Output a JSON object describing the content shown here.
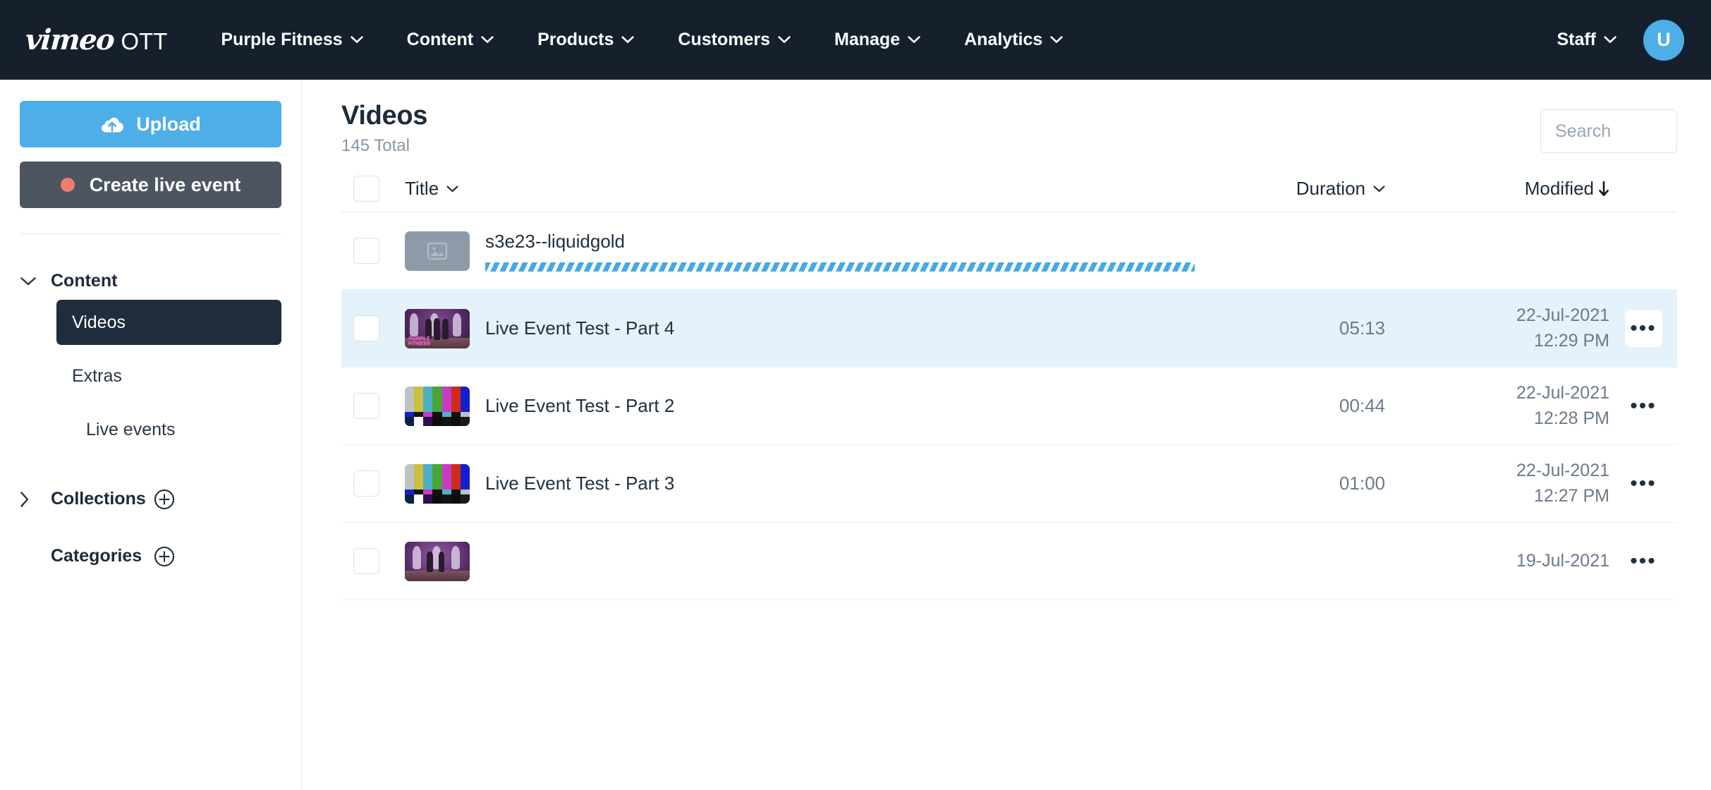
{
  "topnav": {
    "logo": {
      "brand": "vimeo",
      "product": "OTT"
    },
    "items": [
      {
        "label": "Purple Fitness",
        "icon": "chevron-down-icon"
      },
      {
        "label": "Content",
        "icon": "chevron-down-icon"
      },
      {
        "label": "Products",
        "icon": "chevron-down-icon"
      },
      {
        "label": "Customers",
        "icon": "chevron-down-icon"
      },
      {
        "label": "Manage",
        "icon": "chevron-down-icon"
      },
      {
        "label": "Analytics",
        "icon": "chevron-down-icon"
      }
    ],
    "staff": {
      "label": "Staff",
      "icon": "chevron-down-icon"
    },
    "avatar": {
      "initial": "U",
      "color": "#4EAEE8"
    }
  },
  "sidebar": {
    "upload": {
      "label": "Upload",
      "icon": "cloud-upload-icon",
      "color": "#4DAEE8"
    },
    "create_live": {
      "label": "Create live event",
      "icon": "live-dot-icon",
      "color": "#4D5560",
      "dot_color": "#EE7E72"
    },
    "sections": [
      {
        "label": "Content",
        "chevron": "chevron-down-icon",
        "has_plus": false
      },
      {
        "label": "Collections",
        "chevron": "chevron-right-icon",
        "has_plus": true
      },
      {
        "label": "Categories",
        "chevron": "none",
        "has_plus": true
      }
    ],
    "content_items": [
      {
        "label": "Videos",
        "active": true
      },
      {
        "label": "Extras",
        "active": false
      },
      {
        "label": "Live events",
        "active": false
      }
    ]
  },
  "main": {
    "title": "Videos",
    "total": "145 Total",
    "search": {
      "placeholder": "Search",
      "value": "",
      "icon": "search-icon"
    },
    "columns": {
      "title": {
        "label": "Title",
        "sort_icon": "chevron-down-icon"
      },
      "duration": {
        "label": "Duration",
        "sort_icon": "chevron-down-icon"
      },
      "modified": {
        "label": "Modified",
        "sort_icon": "arrow-down-icon"
      }
    },
    "rows": [
      {
        "title": "s3e23--liquidgold",
        "duration": "",
        "modified_date": "",
        "modified_time": "",
        "thumb_type": "placeholder",
        "uploading": true,
        "selected": false,
        "menu_icon": "ellipsis-icon"
      },
      {
        "title": "Live Event Test - Part 4",
        "duration": "05:13",
        "modified_date": "22-Jul-2021",
        "modified_time": "12:29 PM",
        "thumb_type": "purple-fitness",
        "uploading": false,
        "selected": true,
        "menu_icon": "ellipsis-icon"
      },
      {
        "title": "Live Event Test - Part 2",
        "duration": "00:44",
        "modified_date": "22-Jul-2021",
        "modified_time": "12:28 PM",
        "thumb_type": "color-bars",
        "uploading": false,
        "selected": false,
        "menu_icon": "ellipsis-icon"
      },
      {
        "title": "Live Event Test - Part 3",
        "duration": "01:00",
        "modified_date": "22-Jul-2021",
        "modified_time": "12:27 PM",
        "thumb_type": "color-bars",
        "uploading": false,
        "selected": false,
        "menu_icon": "ellipsis-icon"
      },
      {
        "title": "",
        "duration": "",
        "modified_date": "19-Jul-2021",
        "modified_time": "",
        "thumb_type": "purple-fitness-2",
        "uploading": false,
        "selected": false,
        "menu_icon": "ellipsis-icon"
      }
    ]
  },
  "colors": {
    "nav_bg": "#16202D",
    "accent_blue": "#4DAEE8",
    "selected_row": "#E4F2FB",
    "active_nav": "#1F2D3D",
    "text_dark": "#1E2B3A",
    "text_muted": "#6C7A8B"
  }
}
